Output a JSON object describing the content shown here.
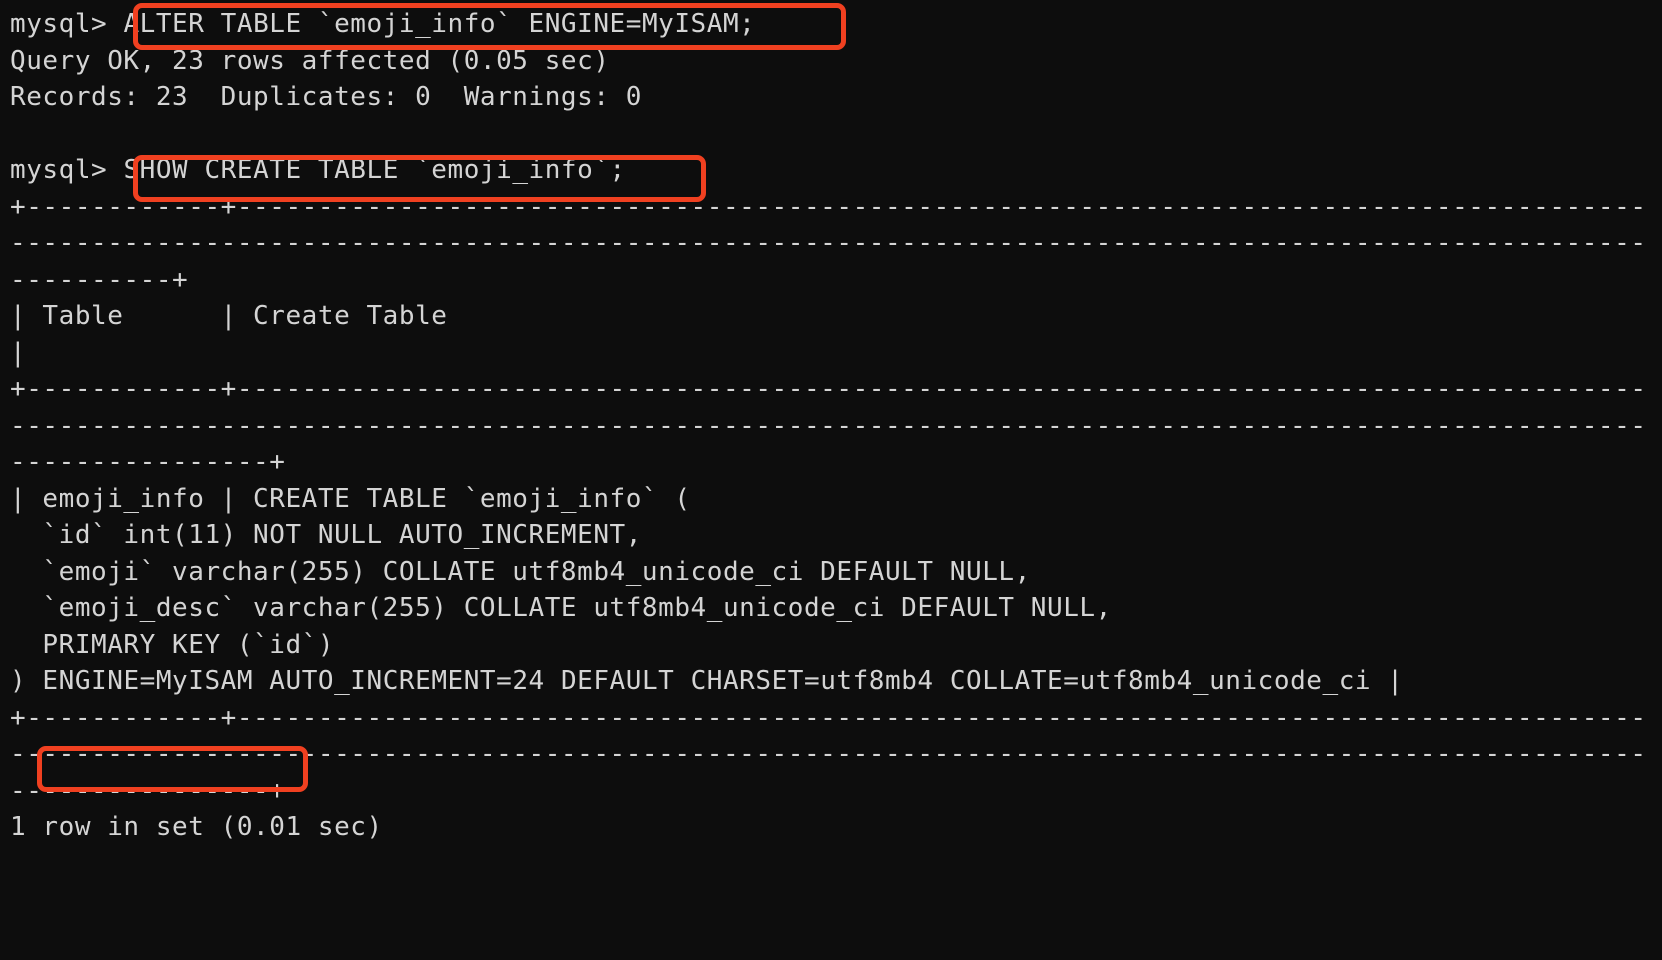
{
  "terminal": {
    "title": "mysql-client-terminal",
    "background_color": "#0d0d0d",
    "foreground_color": "#d4d4d4",
    "highlight_color": "#f04020",
    "columns": 87,
    "prompt": "mysql> "
  },
  "session": {
    "command_1": {
      "prompt": "mysql> ",
      "text": "ALTER TABLE `emoji_info` ENGINE=MyISAM;",
      "highlighted": true
    },
    "result_1_line_1": "Query OK, 23 rows affected (0.05 sec)",
    "result_1_line_2": "Records: 23  Duplicates: 0  Warnings: 0",
    "blank_1": "",
    "command_2": {
      "prompt": "mysql> ",
      "text": "SHOW CREATE TABLE `emoji_info`;",
      "highlighted": true
    },
    "separator_top": "+------------+------------------------------------------------------------------------------------------------------------------------------------------------------------------------------------------------------+",
    "header_row": "| Table      | Create Table                                                                                                                                                                                             |",
    "separator_mid": "+------------+------------------------------------------------------------------------------------------------------------------------------------------------------------------------------------------------------------+",
    "body_line_1": "| emoji_info | CREATE TABLE `emoji_info` (",
    "body_line_2": "  `id` int(11) NOT NULL AUTO_INCREMENT,",
    "body_line_3": "  `emoji` varchar(255) COLLATE utf8mb4_unicode_ci DEFAULT NULL,",
    "body_line_4": "  `emoji_desc` varchar(255) COLLATE utf8mb4_unicode_ci DEFAULT NULL,",
    "body_line_5": "  PRIMARY KEY (`id`)",
    "body_line_6_prefix": ") ",
    "body_line_6_highlight": "ENGINE=MyISAM",
    "body_line_6_suffix": " AUTO_INCREMENT=24 DEFAULT CHARSET=utf8mb4 COLLATE=utf8mb4_unicode_ci |",
    "separator_bottom": "+------------+------------------------------------------------------------------------------------------------------------------------------------------------------------------------------------------------------------+",
    "footer": "1 row in set (0.01 sec)"
  },
  "annotations": {
    "box_1_label": "highlight-alter-table-statement",
    "box_2_label": "highlight-show-create-table-statement",
    "box_3_label": "highlight-engine-myisam"
  }
}
